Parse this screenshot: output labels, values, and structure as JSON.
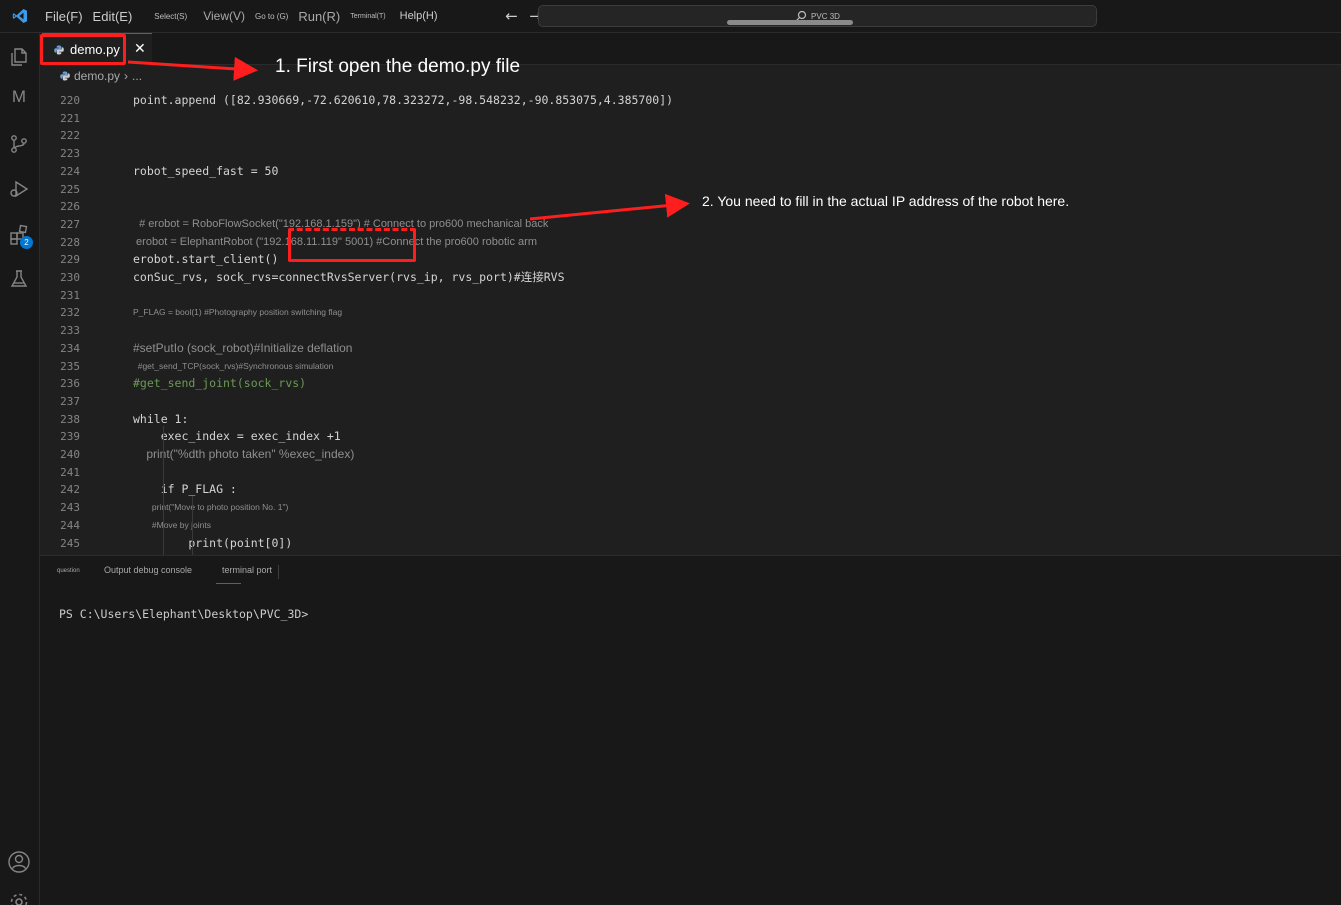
{
  "menu": {
    "file": "File(F)",
    "edit": "Edit(E)",
    "select": "Select(S)",
    "view": "View(V)",
    "goto": "Go to (G)",
    "run": "Run(R)",
    "terminal": "Terminal(T)",
    "help": "Help(H)"
  },
  "search": {
    "text": "PVC 3D"
  },
  "activity": {
    "badge": "2",
    "letter": "M"
  },
  "tab": {
    "label": "demo.py"
  },
  "breadcrumb": {
    "file": "demo.py",
    "more": "..."
  },
  "code_lines": [
    {
      "num": "220",
      "text": "point.append ([82.930669,-72.620610,78.323272,-98.548232,-90.853075,4.385700])",
      "style": "code"
    },
    {
      "num": "221",
      "text": "",
      "style": "code"
    },
    {
      "num": "222",
      "text": "",
      "style": "code"
    },
    {
      "num": "223",
      "text": "",
      "style": "code"
    },
    {
      "num": "224",
      "text": "robot_speed_fast = 50",
      "style": "code"
    },
    {
      "num": "225",
      "text": "",
      "style": "code"
    },
    {
      "num": "226",
      "text": "",
      "style": "code"
    },
    {
      "num": "227",
      "text": "  # erobot = RoboFlowSocket(\"192.168.1.159\") # Connect to pro600 mechanical back",
      "style": "prose11"
    },
    {
      "num": "228",
      "text": " erobot = ElephantRobot (\"192.168.11.119\" 5001) #Connect the pro600 robotic arm",
      "style": "prose11"
    },
    {
      "num": "229",
      "text": "erobot.start_client()",
      "style": "code"
    },
    {
      "num": "230",
      "text": "conSuc_rvs, sock_rvs=connectRvsServer(rvs_ip, rvs_port)#连接RVS",
      "style": "code"
    },
    {
      "num": "231",
      "text": "",
      "style": "code"
    },
    {
      "num": "232",
      "text": "P_FLAG = bool(1) #Photography position switching flag",
      "style": "prose8"
    },
    {
      "num": "233",
      "text": "",
      "style": "code"
    },
    {
      "num": "234",
      "text": "#setPutIo (sock_robot)#Initialize deflation",
      "style": "prose12"
    },
    {
      "num": "235",
      "text": "  #get_send_TCP(sock_rvs)#Synchronous simulation",
      "style": "prose8"
    },
    {
      "num": "236",
      "text": "#get_send_joint(sock_rvs)",
      "style": "comment"
    },
    {
      "num": "237",
      "text": "",
      "style": "code"
    },
    {
      "num": "238",
      "text": "while 1:",
      "style": "code"
    },
    {
      "num": "239",
      "text": "    exec_index = exec_index +1",
      "style": "code"
    },
    {
      "num": "240",
      "text": "    print(\"%dth photo taken\" %exec_index)",
      "style": "prose12"
    },
    {
      "num": "241",
      "text": "",
      "style": "code"
    },
    {
      "num": "242",
      "text": "    if P_FLAG :",
      "style": "code"
    },
    {
      "num": "243",
      "text": "        print(\"Move to photo position No. 1\")",
      "style": "prose8"
    },
    {
      "num": "244",
      "text": "        #Move by joints",
      "style": "prose8"
    },
    {
      "num": "245",
      "text": "        print(point[0])",
      "style": "code"
    }
  ],
  "panel": {
    "tab_question": "question",
    "tab_output": "Output debug console",
    "tab_terminal": "terminal port",
    "terminal_prompt": "PS C:\\Users\\Elephant\\Desktop\\PVC_3D>"
  },
  "annotations": {
    "step1": "1. First open the demo.py file",
    "step2": "2. You need to fill in the actual IP address of the robot here."
  },
  "colors": {
    "annotation_red": "#ff1e1e",
    "accent": "#0078d4",
    "comment_green": "#6a9955"
  },
  "icons": [
    "vscode-logo-icon",
    "explorer-icon",
    "source-control-icon",
    "run-debug-icon",
    "extensions-icon",
    "testing-icon",
    "account-icon",
    "settings-gear-icon",
    "python-file-icon",
    "search-icon",
    "arrow-left-icon",
    "arrow-right-icon",
    "close-icon"
  ]
}
